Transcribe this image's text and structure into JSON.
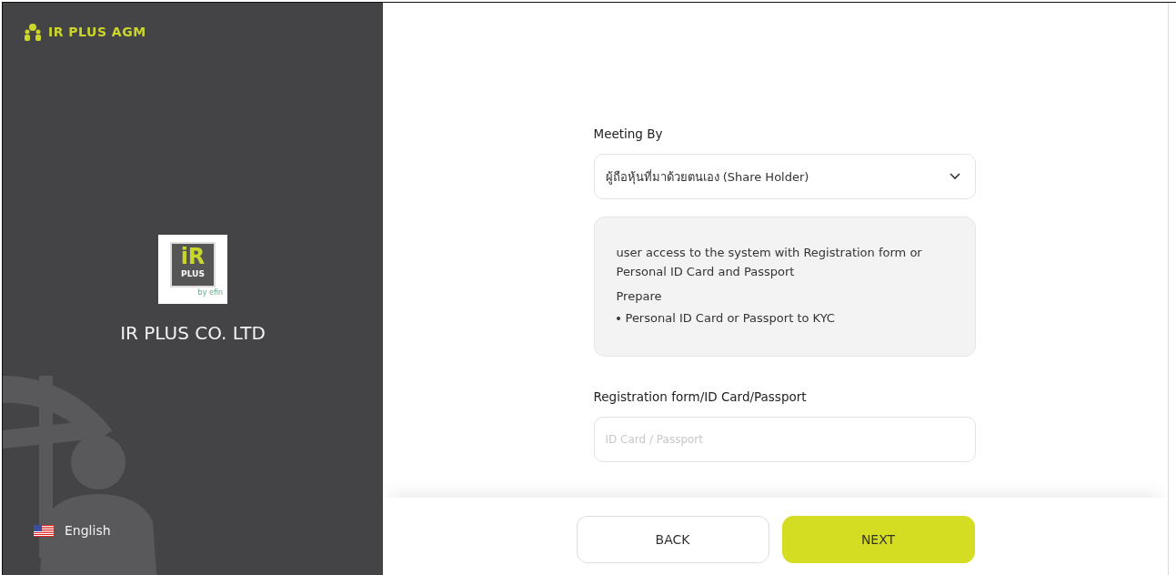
{
  "sidebar": {
    "brand": "IR PLUS AGM",
    "logo": {
      "main": "iR",
      "sub": "PLUS",
      "tag": "by efin"
    },
    "company": "IR PLUS CO. LTD",
    "language": "English"
  },
  "form": {
    "meeting_label": "Meeting By",
    "meeting_value": "ผู้ถือหุ้นที่มาด้วยตนเอง (Share Holder)",
    "info": {
      "text": "user access to the system with Registration form or Personal ID Card and Passport",
      "heading": "Prepare",
      "bullets": [
        "Personal ID Card or Passport to KYC"
      ]
    },
    "id_label": "Registration form/ID Card/Passport",
    "id_placeholder": "ID Card / Passport"
  },
  "buttons": [
    {
      "label": "BACK",
      "kind": "secondary"
    },
    {
      "label": "NEXT",
      "kind": "primary"
    }
  ]
}
